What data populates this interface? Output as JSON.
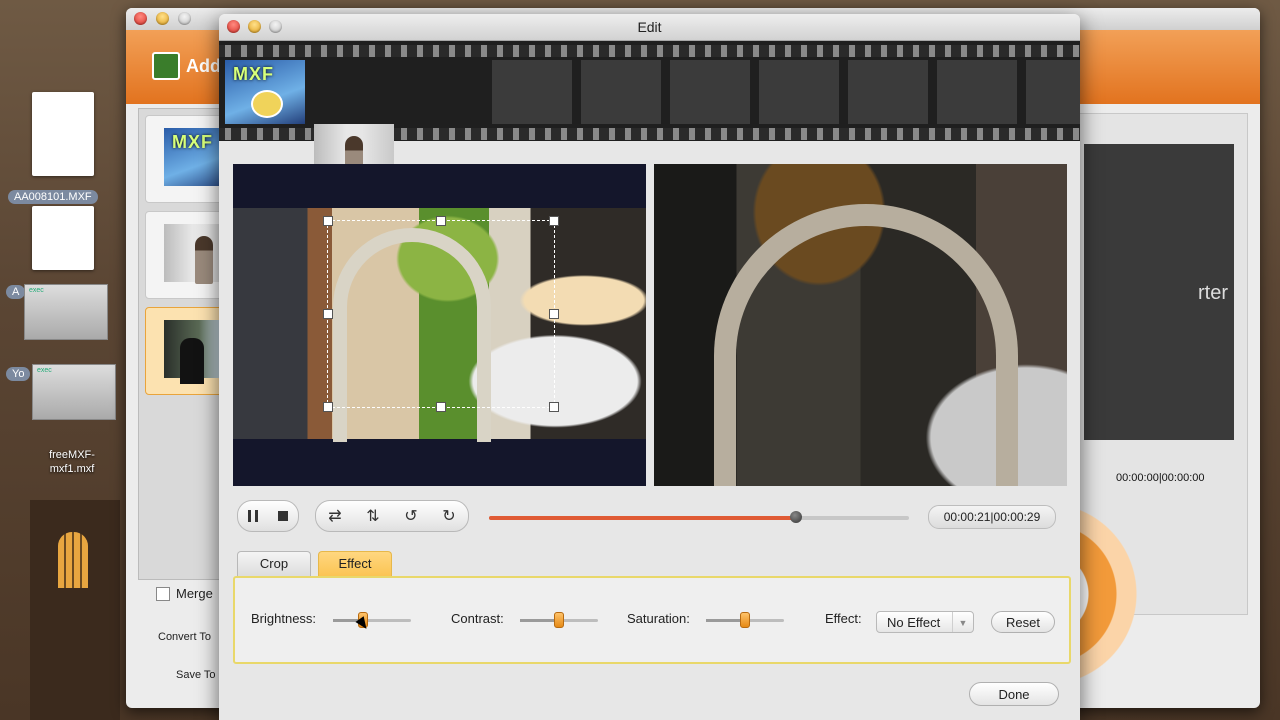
{
  "desktop": {
    "files": [
      {
        "label": "AA008101.MXF"
      },
      {
        "label": "A"
      },
      {
        "label": "Yo"
      },
      {
        "label": "freeMXF-\nmxf1.mxf"
      }
    ],
    "exec_tag": "exec"
  },
  "background_app": {
    "add_label": "Add",
    "merge_label": "Merge",
    "convert_to_label": "Convert To",
    "save_to_label": "Save To",
    "preview_text": "rter",
    "time": "00:00:00|00:00:00"
  },
  "dialog": {
    "title": "Edit",
    "thumbnails": [
      {
        "name": "mxf-logo",
        "text": "MXF",
        "selected": false
      },
      {
        "name": "woman-in-room",
        "selected": false
      },
      {
        "name": "dark-scene",
        "selected": true
      }
    ],
    "controls": {
      "time": "00:00:21|00:00:29",
      "progress": 0.73
    },
    "tabs": [
      {
        "label": "Crop",
        "active": false
      },
      {
        "label": "Effect",
        "active": true
      }
    ],
    "effect": {
      "brightness_label": "Brightness:",
      "brightness": 0.38,
      "contrast_label": "Contrast:",
      "contrast": 0.5,
      "saturation_label": "Saturation:",
      "saturation": 0.5,
      "effect_label": "Effect:",
      "effect_value": "No Effect",
      "reset_label": "Reset"
    },
    "done_label": "Done"
  },
  "colors": {
    "accent_orange": "#e58a16",
    "progress_red": "#e05b35",
    "selection_blue": "#3aa6e8",
    "tab_active": "#fbc453"
  }
}
